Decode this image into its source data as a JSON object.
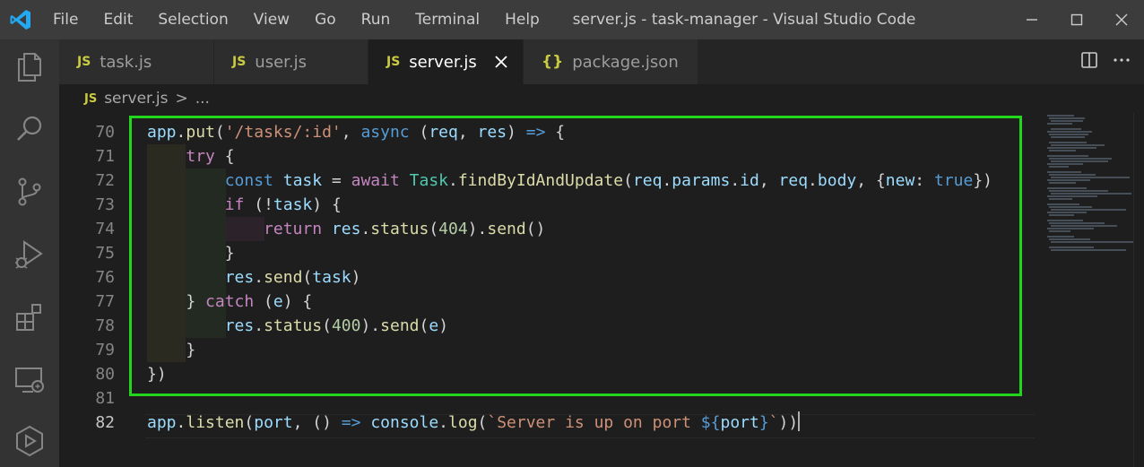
{
  "window": {
    "title": "server.js - task-manager - Visual Studio Code",
    "accent": "#007acc",
    "highlight_color": "#22d61d"
  },
  "menu": [
    "File",
    "Edit",
    "Selection",
    "View",
    "Go",
    "Run",
    "Terminal",
    "Help"
  ],
  "tabs": [
    {
      "icon": "JS",
      "label": "task.js",
      "active": false
    },
    {
      "icon": "JS",
      "label": "user.js",
      "active": false
    },
    {
      "icon": "JS",
      "label": "server.js",
      "active": true
    },
    {
      "icon": "{}",
      "label": "package.json",
      "active": false
    }
  ],
  "breadcrumb": {
    "icon": "JS",
    "file": "server.js",
    "sep": ">",
    "rest": "..."
  },
  "activity_icons": [
    "explorer-icon",
    "search-icon",
    "source-control-icon",
    "run-debug-icon",
    "extensions-icon",
    "remote-explorer-icon",
    "testing-icon"
  ],
  "editor": {
    "lines": [
      {
        "number": "70",
        "tokens": [
          [
            "var",
            "app"
          ],
          [
            "punc",
            "."
          ],
          [
            "fn",
            "put"
          ],
          [
            "punc",
            "("
          ],
          [
            "str",
            "'/tasks/:id'"
          ],
          [
            "punc",
            ", "
          ],
          [
            "kw",
            "async"
          ],
          [
            "punc",
            " ("
          ],
          [
            "var",
            "req"
          ],
          [
            "punc",
            ", "
          ],
          [
            "var",
            "res"
          ],
          [
            "punc",
            ") "
          ],
          [
            "kw",
            "=>"
          ],
          [
            "punc",
            " {"
          ]
        ]
      },
      {
        "number": "71",
        "tokens": [
          [
            "punc",
            "    "
          ],
          [
            "ctrl",
            "try"
          ],
          [
            "punc",
            " {"
          ]
        ]
      },
      {
        "number": "72",
        "tokens": [
          [
            "punc",
            "        "
          ],
          [
            "kw",
            "const"
          ],
          [
            "punc",
            " "
          ],
          [
            "var",
            "task"
          ],
          [
            "punc",
            " = "
          ],
          [
            "ctrl",
            "await"
          ],
          [
            "punc",
            " "
          ],
          [
            "cls",
            "Task"
          ],
          [
            "punc",
            "."
          ],
          [
            "fn",
            "findByIdAndUpdate"
          ],
          [
            "punc",
            "("
          ],
          [
            "var",
            "req"
          ],
          [
            "punc",
            "."
          ],
          [
            "var",
            "params"
          ],
          [
            "punc",
            "."
          ],
          [
            "var",
            "id"
          ],
          [
            "punc",
            ", "
          ],
          [
            "var",
            "req"
          ],
          [
            "punc",
            "."
          ],
          [
            "var",
            "body"
          ],
          [
            "punc",
            ", {"
          ],
          [
            "var",
            "new"
          ],
          [
            "punc",
            ": "
          ],
          [
            "kw",
            "true"
          ],
          [
            "punc",
            "})"
          ]
        ]
      },
      {
        "number": "73",
        "tokens": [
          [
            "punc",
            "        "
          ],
          [
            "ctrl",
            "if"
          ],
          [
            "punc",
            " (!"
          ],
          [
            "var",
            "task"
          ],
          [
            "punc",
            ") {"
          ]
        ]
      },
      {
        "number": "74",
        "tokens": [
          [
            "punc",
            "            "
          ],
          [
            "ctrl",
            "return"
          ],
          [
            "punc",
            " "
          ],
          [
            "var",
            "res"
          ],
          [
            "punc",
            "."
          ],
          [
            "fn",
            "status"
          ],
          [
            "punc",
            "("
          ],
          [
            "num",
            "404"
          ],
          [
            "punc",
            ")."
          ],
          [
            "fn",
            "send"
          ],
          [
            "punc",
            "()"
          ]
        ]
      },
      {
        "number": "75",
        "tokens": [
          [
            "punc",
            "        }"
          ]
        ]
      },
      {
        "number": "76",
        "tokens": [
          [
            "punc",
            "        "
          ],
          [
            "var",
            "res"
          ],
          [
            "punc",
            "."
          ],
          [
            "fn",
            "send"
          ],
          [
            "punc",
            "("
          ],
          [
            "var",
            "task"
          ],
          [
            "punc",
            ")"
          ]
        ]
      },
      {
        "number": "77",
        "tokens": [
          [
            "punc",
            "    } "
          ],
          [
            "ctrl",
            "catch"
          ],
          [
            "punc",
            " ("
          ],
          [
            "var",
            "e"
          ],
          [
            "punc",
            ") {"
          ]
        ]
      },
      {
        "number": "78",
        "tokens": [
          [
            "punc",
            "        "
          ],
          [
            "var",
            "res"
          ],
          [
            "punc",
            "."
          ],
          [
            "fn",
            "status"
          ],
          [
            "punc",
            "("
          ],
          [
            "num",
            "400"
          ],
          [
            "punc",
            ")."
          ],
          [
            "fn",
            "send"
          ],
          [
            "punc",
            "("
          ],
          [
            "var",
            "e"
          ],
          [
            "punc",
            ")"
          ]
        ]
      },
      {
        "number": "79",
        "tokens": [
          [
            "punc",
            "    }"
          ]
        ]
      },
      {
        "number": "80",
        "tokens": [
          [
            "punc",
            "})"
          ]
        ]
      },
      {
        "number": "81",
        "tokens": []
      },
      {
        "number": "82",
        "tokens": [
          [
            "var",
            "app"
          ],
          [
            "punc",
            "."
          ],
          [
            "fn",
            "listen"
          ],
          [
            "punc",
            "("
          ],
          [
            "var",
            "port"
          ],
          [
            "punc",
            ", () "
          ],
          [
            "kw",
            "=>"
          ],
          [
            "punc",
            " "
          ],
          [
            "var",
            "console"
          ],
          [
            "punc",
            "."
          ],
          [
            "fn",
            "log"
          ],
          [
            "punc",
            "("
          ],
          [
            "str",
            "`Server is up on port "
          ],
          [
            "kw",
            "${"
          ],
          [
            "var",
            "port"
          ],
          [
            "kw",
            "}"
          ],
          [
            "str",
            "`"
          ],
          [
            "punc",
            "))"
          ]
        ]
      }
    ],
    "current_line": "82"
  }
}
